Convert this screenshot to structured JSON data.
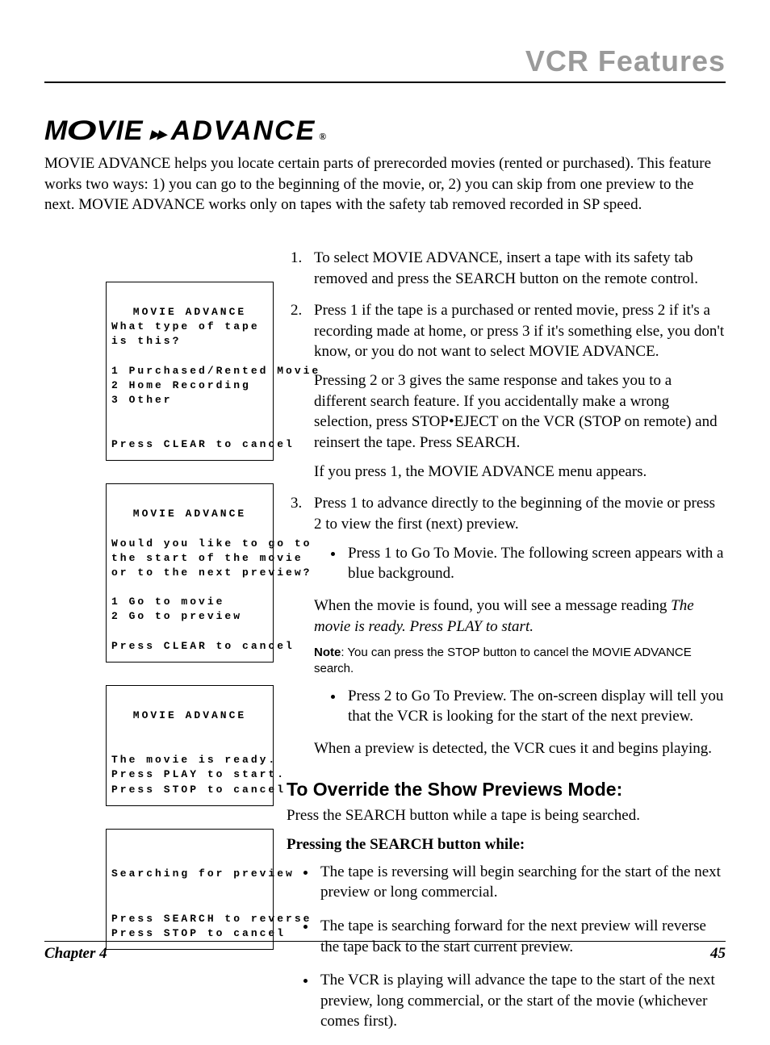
{
  "header": "VCR Features",
  "logo": {
    "movie": "MOVIE",
    "advance": "ADVANCE",
    "reg": "®"
  },
  "intro": "MOVIE ADVANCE helps you locate certain parts of prerecorded movies (rented or purchased). This feature works two ways: 1) you can go to the beginning of the movie, or, 2) you can skip from one preview to the next. MOVIE ADVANCE works only on tapes with the safety tab removed recorded in SP speed.",
  "osd1": {
    "title": "MOVIE ADVANCE",
    "l1": "What type of tape",
    "l2": "is this?",
    "o1": "1 Purchased/Rented Movie",
    "o2": "2 Home Recording",
    "o3": "3 Other",
    "cancel": "Press CLEAR to cancel"
  },
  "osd2": {
    "title": "MOVIE ADVANCE",
    "l1": "Would you like to go to",
    "l2": "the start of the movie",
    "l3": "or to the next preview?",
    "o1": "1 Go to movie",
    "o2": "2 Go to preview",
    "cancel": "Press CLEAR to cancel"
  },
  "osd3": {
    "title": "MOVIE ADVANCE",
    "l1": "The movie is ready.",
    "l2": "Press PLAY to start.",
    "cancel": "Press STOP to cancel"
  },
  "osd4": {
    "l1": "Searching for preview",
    "b1": "Press SEARCH to reverse",
    "b2": "Press STOP to cancel"
  },
  "step1": "To select MOVIE ADVANCE, insert a tape with its safety tab removed and press the SEARCH button on the remote control.",
  "step2a": "Press 1 if the tape is a purchased or rented movie, press 2 if it's a recording made at home, or press 3 if it's something else, you don't know, or you do not want to select MOVIE ADVANCE.",
  "step2b": "Pressing 2 or 3 gives the same response and takes you to a different search feature. If you accidentally make a wrong selection, press STOP•EJECT on the VCR (STOP on remote) and reinsert the tape. Press SEARCH.",
  "step2c": "If you press 1, the MOVIE ADVANCE menu appears.",
  "step3a": "Press 1 to advance directly to the beginning of the movie or press 2 to view the first (next) preview.",
  "step3b1": "Press 1 to Go To Movie. The following screen appears with a blue background.",
  "step3b2a": "When the movie is found, you will see a message reading ",
  "step3b2b": "The movie is ready. Press PLAY to start.",
  "noteLabel": "Note",
  "noteText": ": You can press the STOP button to  cancel the MOVIE ADVANCE search.",
  "step3c": "Press 2 to Go To Preview. The on-screen display will tell you that the VCR is looking for the start of the next preview.",
  "step3d": "When a preview is detected, the VCR cues it and begins playing.",
  "overrideTitle": "To Override the Show Previews Mode:",
  "overrideIntro": "Press the SEARCH button while a tape is being searched.",
  "overrideSub": "Pressing the SEARCH button while:",
  "ov1": "The tape is reversing will begin searching for the start of the next preview or long commercial.",
  "ov2": "The tape is searching forward for the next preview will reverse the tape back to the start current preview.",
  "ov3": "The VCR is playing will advance the tape to the start of the next preview, long commercial, or the start of the movie (whichever comes first).",
  "footer": {
    "chapter": "Chapter 4",
    "page": "45"
  }
}
